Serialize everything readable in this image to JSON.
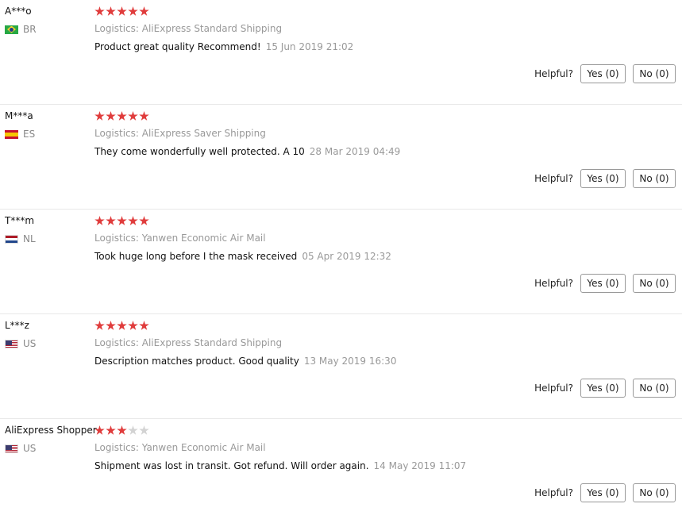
{
  "reviews": [
    {
      "buyer": "A***o",
      "country": "BR",
      "flag": "flag-br",
      "stars": 5,
      "logistics": "Logistics: AliExpress Standard Shipping",
      "feedback": "Product great quality Recommend!",
      "date": "15 Jun 2019 21:02",
      "helpful_label": "Helpful?",
      "yes_label": "Yes (0)",
      "no_label": "No (0)"
    },
    {
      "buyer": "M***a",
      "country": "ES",
      "flag": "flag-es",
      "stars": 5,
      "logistics": "Logistics: AliExpress Saver Shipping",
      "feedback": "They come wonderfully well protected. A 10",
      "date": "28 Mar 2019 04:49",
      "helpful_label": "Helpful?",
      "yes_label": "Yes (0)",
      "no_label": "No (0)"
    },
    {
      "buyer": "T***m",
      "country": "NL",
      "flag": "flag-nl",
      "stars": 5,
      "logistics": "Logistics: Yanwen Economic Air Mail",
      "feedback": "Took huge long before I the mask received",
      "date": "05 Apr 2019 12:32",
      "helpful_label": "Helpful?",
      "yes_label": "Yes (0)",
      "no_label": "No (0)"
    },
    {
      "buyer": "L***z",
      "country": "US",
      "flag": "flag-us",
      "stars": 5,
      "logistics": "Logistics: AliExpress Standard Shipping",
      "feedback": "Description matches product. Good quality",
      "date": "13 May 2019 16:30",
      "helpful_label": "Helpful?",
      "yes_label": "Yes (0)",
      "no_label": "No (0)"
    },
    {
      "buyer": "AliExpress Shopper",
      "country": "US",
      "flag": "flag-us",
      "stars": 3,
      "logistics": "Logistics: Yanwen Economic Air Mail",
      "feedback": "Shipment was lost in transit. Got refund. Will order again.",
      "date": "14 May 2019 11:07",
      "helpful_label": "Helpful?",
      "yes_label": "Yes (0)",
      "no_label": "No (0)"
    }
  ],
  "star_max": 5,
  "colors": {
    "star_on": "#e03c3c",
    "star_off": "#d3d3d3",
    "muted_text": "#999999"
  }
}
